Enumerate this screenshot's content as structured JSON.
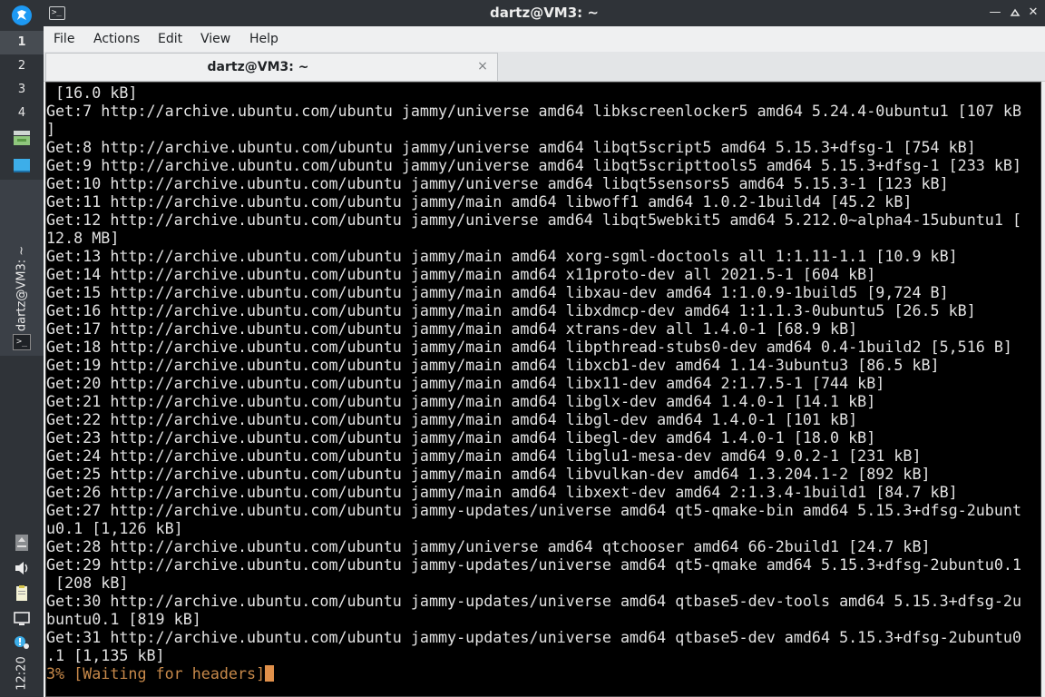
{
  "panel": {
    "workspaces": [
      "1",
      "2",
      "3",
      "4"
    ],
    "active_workspace": "1",
    "task_label": "dartz@VM3: ~",
    "clock": "12:20",
    "icons": [
      "start-menu-icon",
      "file-manager-icon",
      "desktop-icon",
      "terminal-icon",
      "removable-drive-icon",
      "volume-icon",
      "clipboard-icon",
      "network-icon",
      "notification-icon"
    ]
  },
  "window": {
    "title": "dartz@VM3: ~",
    "icon": "terminal-icon",
    "buttons": [
      "minimize-icon",
      "maximize-icon",
      "close-icon"
    ]
  },
  "menu": {
    "file": "File",
    "actions": "Actions",
    "edit": "Edit",
    "view": "View",
    "help": "Help"
  },
  "tab": {
    "title": "dartz@VM3: ~",
    "close": "×"
  },
  "terminal": {
    "lines": [
      " [16.0 kB]",
      "Get:7 http://archive.ubuntu.com/ubuntu jammy/universe amd64 libkscreenlocker5 amd64 5.24.4-0ubuntu1 [107 kB",
      "]",
      "Get:8 http://archive.ubuntu.com/ubuntu jammy/universe amd64 libqt5script5 amd64 5.15.3+dfsg-1 [754 kB]",
      "Get:9 http://archive.ubuntu.com/ubuntu jammy/universe amd64 libqt5scripttools5 amd64 5.15.3+dfsg-1 [233 kB]",
      "Get:10 http://archive.ubuntu.com/ubuntu jammy/universe amd64 libqt5sensors5 amd64 5.15.3-1 [123 kB]",
      "Get:11 http://archive.ubuntu.com/ubuntu jammy/main amd64 libwoff1 amd64 1.0.2-1build4 [45.2 kB]",
      "Get:12 http://archive.ubuntu.com/ubuntu jammy/universe amd64 libqt5webkit5 amd64 5.212.0~alpha4-15ubuntu1 [",
      "12.8 MB]",
      "Get:13 http://archive.ubuntu.com/ubuntu jammy/main amd64 xorg-sgml-doctools all 1:1.11-1.1 [10.9 kB]",
      "Get:14 http://archive.ubuntu.com/ubuntu jammy/main amd64 x11proto-dev all 2021.5-1 [604 kB]",
      "Get:15 http://archive.ubuntu.com/ubuntu jammy/main amd64 libxau-dev amd64 1:1.0.9-1build5 [9,724 B]",
      "Get:16 http://archive.ubuntu.com/ubuntu jammy/main amd64 libxdmcp-dev amd64 1:1.1.3-0ubuntu5 [26.5 kB]",
      "Get:17 http://archive.ubuntu.com/ubuntu jammy/main amd64 xtrans-dev all 1.4.0-1 [68.9 kB]",
      "Get:18 http://archive.ubuntu.com/ubuntu jammy/main amd64 libpthread-stubs0-dev amd64 0.4-1build2 [5,516 B]",
      "Get:19 http://archive.ubuntu.com/ubuntu jammy/main amd64 libxcb1-dev amd64 1.14-3ubuntu3 [86.5 kB]",
      "Get:20 http://archive.ubuntu.com/ubuntu jammy/main amd64 libx11-dev amd64 2:1.7.5-1 [744 kB]",
      "Get:21 http://archive.ubuntu.com/ubuntu jammy/main amd64 libglx-dev amd64 1.4.0-1 [14.1 kB]",
      "Get:22 http://archive.ubuntu.com/ubuntu jammy/main amd64 libgl-dev amd64 1.4.0-1 [101 kB]",
      "Get:23 http://archive.ubuntu.com/ubuntu jammy/main amd64 libegl-dev amd64 1.4.0-1 [18.0 kB]",
      "Get:24 http://archive.ubuntu.com/ubuntu jammy/main amd64 libglu1-mesa-dev amd64 9.0.2-1 [231 kB]",
      "Get:25 http://archive.ubuntu.com/ubuntu jammy/main amd64 libvulkan-dev amd64 1.3.204.1-2 [892 kB]",
      "Get:26 http://archive.ubuntu.com/ubuntu jammy/main amd64 libxext-dev amd64 2:1.3.4-1build1 [84.7 kB]",
      "Get:27 http://archive.ubuntu.com/ubuntu jammy-updates/universe amd64 qt5-qmake-bin amd64 5.15.3+dfsg-2ubunt",
      "u0.1 [1,126 kB]",
      "Get:28 http://archive.ubuntu.com/ubuntu jammy/universe amd64 qtchooser amd64 66-2build1 [24.7 kB]",
      "Get:29 http://archive.ubuntu.com/ubuntu jammy-updates/universe amd64 qt5-qmake amd64 5.15.3+dfsg-2ubuntu0.1",
      " [208 kB]",
      "Get:30 http://archive.ubuntu.com/ubuntu jammy-updates/universe amd64 qtbase5-dev-tools amd64 5.15.3+dfsg-2u",
      "buntu0.1 [819 kB]",
      "Get:31 http://archive.ubuntu.com/ubuntu jammy-updates/universe amd64 qtbase5-dev amd64 5.15.3+dfsg-2ubuntu0",
      ".1 [1,135 kB]"
    ],
    "status_line": "3% [Waiting for headers]",
    "text_color": "#e2e2e2",
    "status_color": "#c7894a",
    "background": "#000000"
  }
}
